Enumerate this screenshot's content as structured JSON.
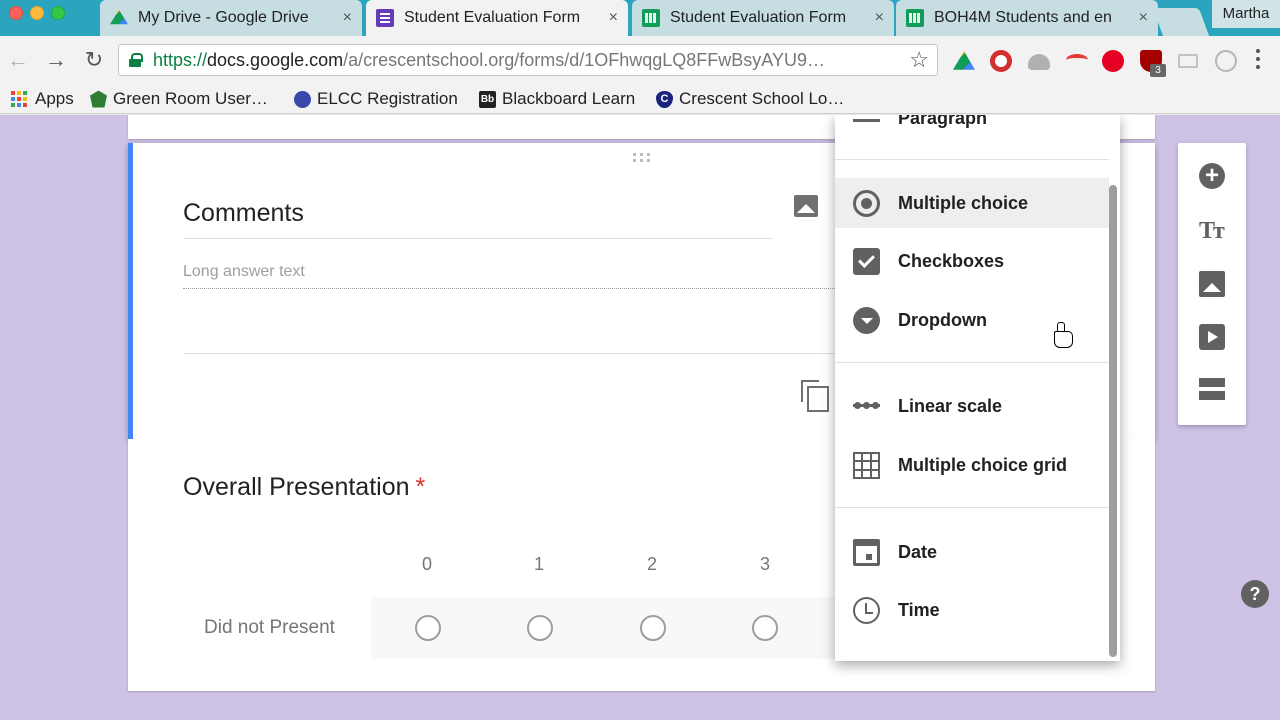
{
  "browser": {
    "tabs": [
      {
        "title": "My Drive - Google Drive",
        "icon": "google-drive-icon",
        "close": "×"
      },
      {
        "title": "Student Evaluation Form",
        "icon": "google-forms-icon",
        "close": "×"
      },
      {
        "title": "Student Evaluation Form",
        "icon": "google-sheets-icon",
        "close": "×"
      },
      {
        "title": "BOH4M Students and en",
        "icon": "google-sheets-icon",
        "close": "×"
      }
    ],
    "profile_name": "Martha",
    "url_scheme": "https://",
    "url_host": "docs.google.com",
    "url_path": "/a/crescentschool.org/forms/d/1OFhwqgLQ8FFwBsyAYU9…",
    "extension_badge": "3",
    "bookmarks": [
      {
        "label": "Apps",
        "icon": "apps-grid-icon"
      },
      {
        "label": "Green Room User…",
        "icon": "green-room-icon"
      },
      {
        "label": "ELCC Registration",
        "icon": "elcc-icon"
      },
      {
        "label": "Blackboard Learn",
        "icon": "blackboard-icon",
        "icon_text": "Bb"
      },
      {
        "label": "Crescent School Lo…",
        "icon": "crescent-icon",
        "icon_text": "C"
      }
    ]
  },
  "form": {
    "prev_item_label": "Paragraph",
    "question1": {
      "title": "Comments",
      "placeholder": "Long answer text"
    },
    "question2": {
      "title": "Overall Presentation",
      "required_mark": "*",
      "columns": [
        "0",
        "1",
        "2",
        "3"
      ],
      "row_label": "Did not Present"
    }
  },
  "type_menu": {
    "items": [
      {
        "label": "Paragraph",
        "icon": "paragraph-icon"
      },
      {
        "label": "Multiple choice",
        "icon": "radio-icon",
        "selected": true
      },
      {
        "label": "Checkboxes",
        "icon": "checkbox-icon"
      },
      {
        "label": "Dropdown",
        "icon": "dropdown-icon"
      },
      {
        "label": "Linear scale",
        "icon": "linear-scale-icon"
      },
      {
        "label": "Multiple choice grid",
        "icon": "grid-icon"
      },
      {
        "label": "Date",
        "icon": "calendar-icon"
      },
      {
        "label": "Time",
        "icon": "clock-icon"
      }
    ]
  },
  "side_toolbar": {
    "items": [
      "add-question-icon",
      "add-title-icon",
      "add-image-icon",
      "add-video-icon",
      "add-section-icon"
    ],
    "title_glyph": "Tт",
    "add_glyph": "+"
  },
  "help_glyph": "?",
  "colors": {
    "tabstrip": "#2aa5bd",
    "page_background": "#cfc2e7",
    "active_card_accent": "#4285f4",
    "required": "#d93025"
  }
}
